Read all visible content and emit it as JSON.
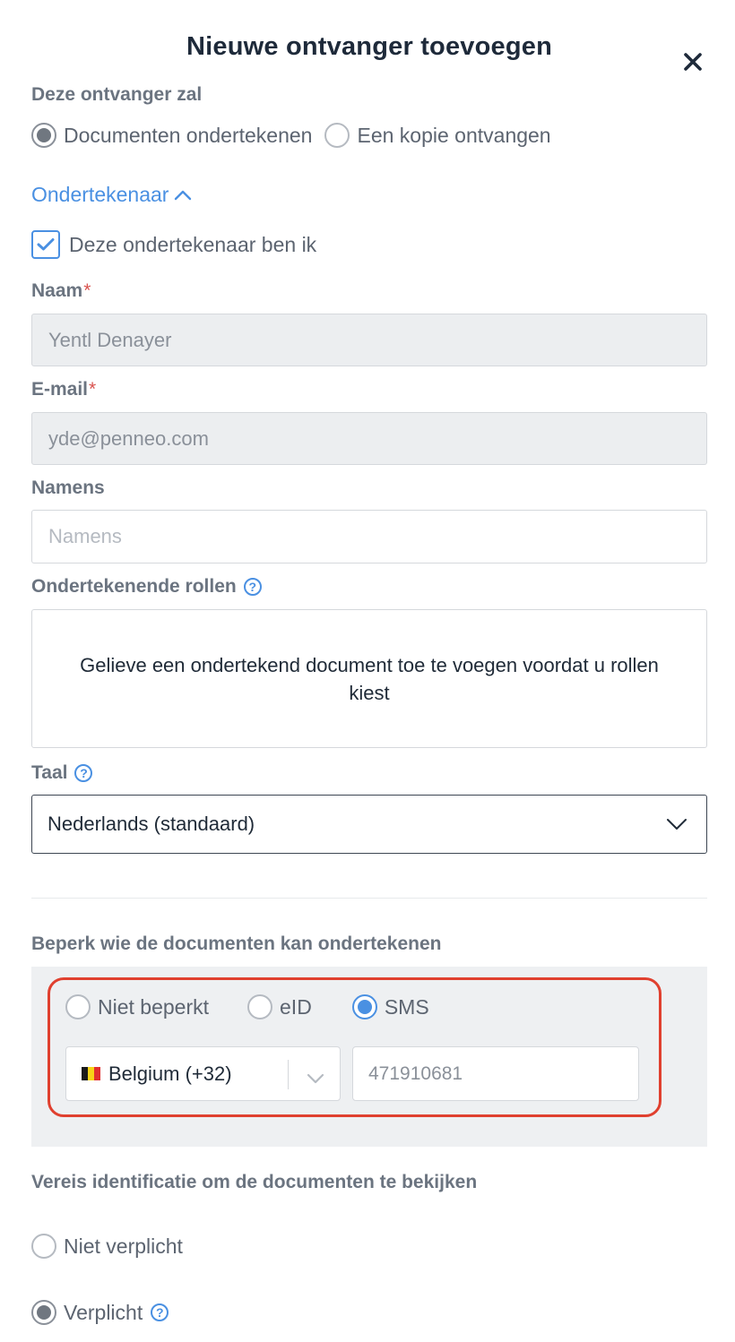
{
  "dialog": {
    "title": "Nieuwe ontvanger toevoegen"
  },
  "recipient_type": {
    "label": "Deze ontvanger zal",
    "options": [
      "Documenten ondertekenen",
      "Een kopie ontvangen"
    ],
    "selected": "Documenten ondertekenen"
  },
  "signer_section": {
    "toggle_label": "Ondertekenaar",
    "self_checkbox_label": "Deze ondertekenaar ben ik",
    "self_checked": true
  },
  "name": {
    "label": "Naam",
    "required_mark": "*",
    "value": "Yentl Denayer"
  },
  "email": {
    "label": "E-mail",
    "required_mark": "*",
    "value": "yde@penneo.com"
  },
  "on_behalf": {
    "label": "Namens",
    "placeholder": "Namens",
    "value": ""
  },
  "signing_roles": {
    "label": "Ondertekenende rollen",
    "help": "?",
    "message": "Gelieve een ondertekend document toe te voegen voordat u rollen kiest"
  },
  "language": {
    "label": "Taal",
    "help": "?",
    "selected": "Nederlands (standaard)"
  },
  "restrict": {
    "label": "Beperk wie de documenten kan ondertekenen",
    "options": [
      "Niet beperkt",
      "eID",
      "SMS"
    ],
    "selected": "SMS",
    "country": "Belgium (+32)",
    "phone_placeholder": "471910681"
  },
  "view_identification": {
    "label": "Vereis identificatie om de documenten te bekijken",
    "options": [
      "Niet verplicht",
      "Verplicht"
    ],
    "selected": "Verplicht",
    "help": "?"
  },
  "colors": {
    "accent": "#4a90e2",
    "required": "#d9534f",
    "highlight": "#e0402f"
  }
}
